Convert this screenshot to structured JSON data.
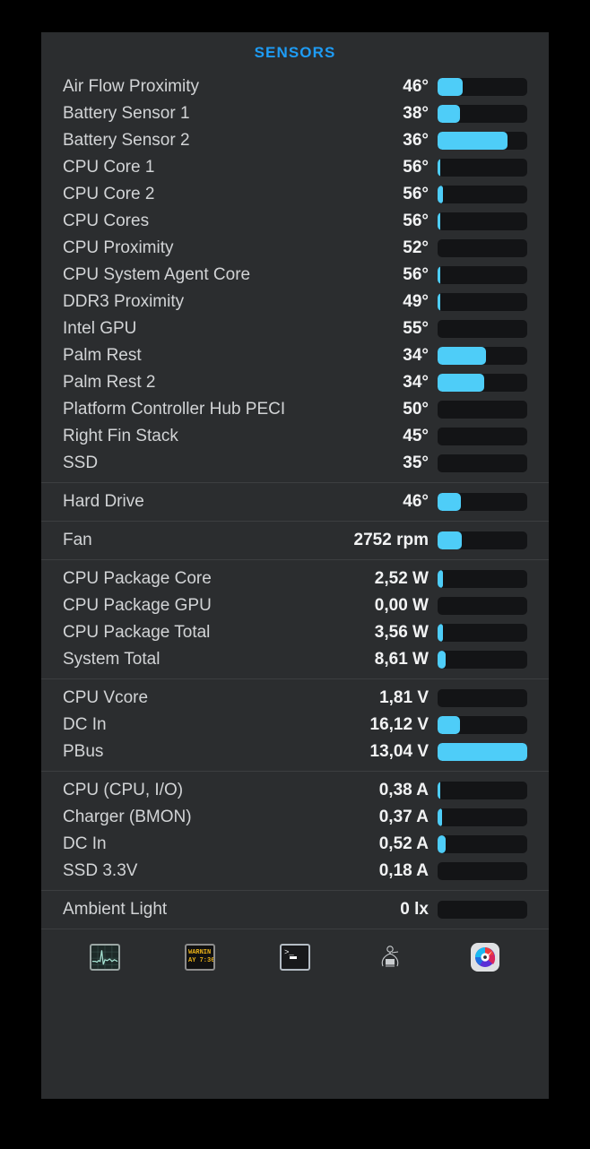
{
  "panel": {
    "title": "SENSORS",
    "accent_color": "#1e9cf5",
    "bar_fill_color": "#4ecdf8",
    "bar_track_color": "#131416",
    "background_color": "#2b2d2f"
  },
  "sections": [
    {
      "name": "temperatures",
      "rows": [
        {
          "label": "Air Flow Proximity",
          "value": "46°",
          "fill_pct": 28
        },
        {
          "label": "Battery Sensor 1",
          "value": "38°",
          "fill_pct": 25
        },
        {
          "label": "Battery Sensor 2",
          "value": "36°",
          "fill_pct": 78
        },
        {
          "label": "CPU Core 1",
          "value": "56°",
          "fill_pct": 3
        },
        {
          "label": "CPU Core 2",
          "value": "56°",
          "fill_pct": 6
        },
        {
          "label": "CPU Cores",
          "value": "56°",
          "fill_pct": 3
        },
        {
          "label": "CPU Proximity",
          "value": "52°",
          "fill_pct": 0
        },
        {
          "label": "CPU System Agent Core",
          "value": "56°",
          "fill_pct": 3
        },
        {
          "label": "DDR3 Proximity",
          "value": "49°",
          "fill_pct": 3
        },
        {
          "label": "Intel GPU",
          "value": "55°",
          "fill_pct": 0
        },
        {
          "label": "Palm Rest",
          "value": "34°",
          "fill_pct": 54
        },
        {
          "label": "Palm Rest 2",
          "value": "34°",
          "fill_pct": 52
        },
        {
          "label": "Platform Controller Hub PECI",
          "value": "50°",
          "fill_pct": 0
        },
        {
          "label": "Right Fin Stack",
          "value": "45°",
          "fill_pct": 0
        },
        {
          "label": "SSD",
          "value": "35°",
          "fill_pct": 0
        }
      ]
    },
    {
      "name": "drives",
      "rows": [
        {
          "label": "Hard Drive",
          "value": "46°",
          "fill_pct": 26
        }
      ]
    },
    {
      "name": "fans",
      "rows": [
        {
          "label": "Fan",
          "value": "2752 rpm",
          "fill_pct": 27
        }
      ]
    },
    {
      "name": "power",
      "rows": [
        {
          "label": "CPU Package Core",
          "value": "2,52 W",
          "fill_pct": 6
        },
        {
          "label": "CPU Package GPU",
          "value": "0,00 W",
          "fill_pct": 0
        },
        {
          "label": "CPU Package Total",
          "value": "3,56 W",
          "fill_pct": 6
        },
        {
          "label": "System Total",
          "value": "8,61 W",
          "fill_pct": 9
        }
      ]
    },
    {
      "name": "voltages",
      "rows": [
        {
          "label": "CPU Vcore",
          "value": "1,81 V",
          "fill_pct": 0
        },
        {
          "label": "DC In",
          "value": "16,12 V",
          "fill_pct": 25
        },
        {
          "label": "PBus",
          "value": "13,04 V",
          "fill_pct": 100
        }
      ]
    },
    {
      "name": "currents",
      "rows": [
        {
          "label": "CPU (CPU, I/O)",
          "value": "0,38 A",
          "fill_pct": 3
        },
        {
          "label": "Charger (BMON)",
          "value": "0,37 A",
          "fill_pct": 5
        },
        {
          "label": "DC In",
          "value": "0,52 A",
          "fill_pct": 9
        },
        {
          "label": "SSD 3.3V",
          "value": "0,18 A",
          "fill_pct": 0
        }
      ]
    },
    {
      "name": "light",
      "rows": [
        {
          "label": "Ambient Light",
          "value": "0 lx",
          "fill_pct": 0
        }
      ]
    }
  ],
  "toolbar": {
    "items": [
      {
        "icon": "activity-monitor-icon"
      },
      {
        "icon": "console-icon",
        "line1": "WARNIN",
        "line2": "AY 7:36"
      },
      {
        "icon": "terminal-icon",
        "prompt": ">_"
      },
      {
        "icon": "hardware-monitor-icon"
      },
      {
        "icon": "istat-menus-icon"
      }
    ]
  }
}
